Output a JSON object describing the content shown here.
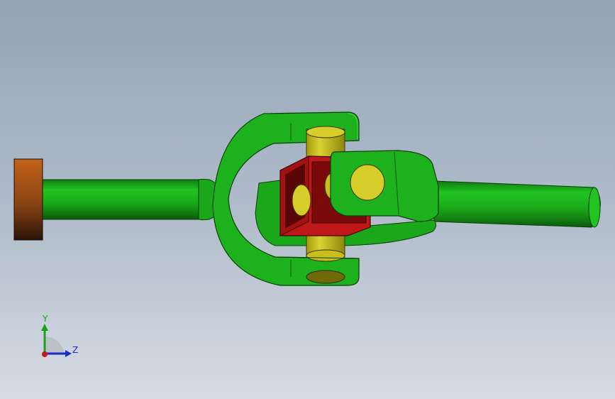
{
  "viewport": {
    "background_top": "#94a3b6",
    "background_bottom": "#d7dce4"
  },
  "model": {
    "colors": {
      "shaft": "#1fb41f",
      "shaft_dark": "#0a4e0a",
      "yoke": "#1db21d",
      "pin": "#c9c11a",
      "pin_dark": "#6e6a08",
      "cross_block": "#c01818",
      "cross_dark": "#5a0606",
      "end_cap_top": "#c2621a",
      "end_cap_bottom": "#2a1408"
    }
  },
  "triad": {
    "y_label": "Y",
    "z_label": "Z",
    "y_color": "#1aa01a",
    "z_color": "#1b2cc8",
    "x_color": "#c81818"
  }
}
